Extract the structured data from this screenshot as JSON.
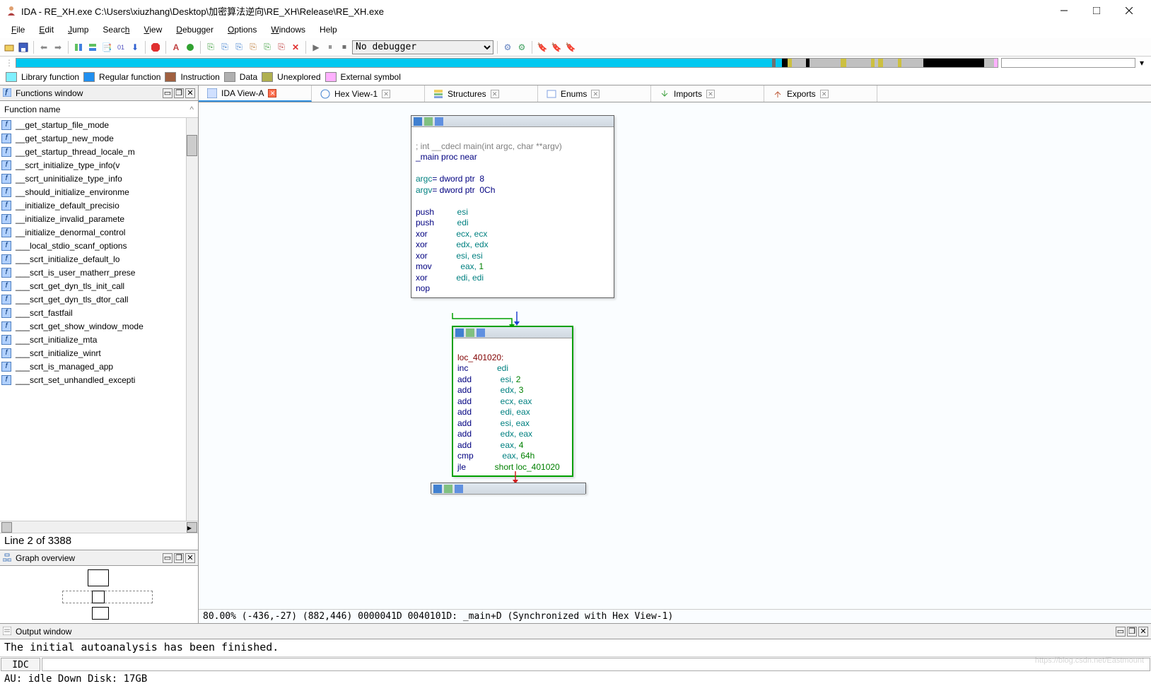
{
  "titlebar": {
    "title": "IDA - RE_XH.exe C:\\Users\\xiuzhang\\Desktop\\加密算法逆向\\RE_XH\\Release\\RE_XH.exe"
  },
  "menu": {
    "file": "File",
    "edit": "Edit",
    "jump": "Jump",
    "search": "Search",
    "view": "View",
    "debugger": "Debugger",
    "options": "Options",
    "windows": "Windows",
    "help": "Help"
  },
  "toolbar": {
    "debugger_select": "No debugger"
  },
  "legend": {
    "lib": "Library function",
    "reg": "Regular function",
    "ins": "Instruction",
    "data": "Data",
    "unex": "Unexplored",
    "ext": "External symbol"
  },
  "functions_panel": {
    "title": "Functions window",
    "header": "Function name",
    "items": [
      "__get_startup_file_mode",
      "__get_startup_new_mode",
      "__get_startup_thread_locale_m",
      "__scrt_initialize_type_info(v",
      "__scrt_uninitialize_type_info",
      "__should_initialize_environme",
      "__initialize_default_precisio",
      "__initialize_invalid_paramete",
      "__initialize_denormal_control",
      "___local_stdio_scanf_options",
      "___scrt_initialize_default_lo",
      "___scrt_is_user_matherr_prese",
      "___scrt_get_dyn_tls_init_call",
      "___scrt_get_dyn_tls_dtor_call",
      "___scrt_fastfail",
      "___scrt_get_show_window_mode",
      "___scrt_initialize_mta",
      "___scrt_initialize_winrt",
      "___scrt_is_managed_app",
      "___scrt_set_unhandled_excepti"
    ],
    "status": "Line 2 of 3388"
  },
  "graph_overview": {
    "title": "Graph overview"
  },
  "tabs": {
    "ida_view": "IDA View-A",
    "hex_view": "Hex View-1",
    "structures": "Structures",
    "enums": "Enums",
    "imports": "Imports",
    "exports": "Exports"
  },
  "block1": {
    "comment": "; int __cdecl main(int argc, char **argv)",
    "proc": "_main proc near",
    "argc_lbl": "argc",
    "argc_def": "= dword ptr  8",
    "argv_lbl": "argv",
    "argv_def": "= dword ptr  0Ch",
    "i1a": "push",
    "i1b": "esi",
    "i2a": "push",
    "i2b": "edi",
    "i3a": "xor",
    "i3b": "ecx, ecx",
    "i4a": "xor",
    "i4b": "edx, edx",
    "i5a": "xor",
    "i5b": "esi, esi",
    "i6a": "mov",
    "i6b": "eax, ",
    "i6c": "1",
    "i7a": "xor",
    "i7b": "edi, edi",
    "i8a": "nop"
  },
  "block2": {
    "loc": "loc_401020:",
    "l1a": "inc",
    "l1b": "edi",
    "l2a": "add",
    "l2b": "esi, ",
    "l2c": "2",
    "l3a": "add",
    "l3b": "edx, ",
    "l3c": "3",
    "l4a": "add",
    "l4b": "ecx, eax",
    "l5a": "add",
    "l5b": "edi, eax",
    "l6a": "add",
    "l6b": "esi, eax",
    "l7a": "add",
    "l7b": "edx, eax",
    "l8a": "add",
    "l8b": "eax, ",
    "l8c": "4",
    "l9a": "cmp",
    "l9b": "eax, ",
    "l9c": "64h",
    "l10a": "jle",
    "l10b": "short loc_401020"
  },
  "graph_status": "80.00% (-436,-27) (882,446) 0000041D 0040101D: _main+D (Synchronized with Hex View-1)",
  "output_panel": {
    "title": "Output window",
    "text": "The initial autoanalysis has been finished."
  },
  "idc": {
    "label": "IDC"
  },
  "bottom_status": "AU: idle   Down    Disk: 17GB"
}
